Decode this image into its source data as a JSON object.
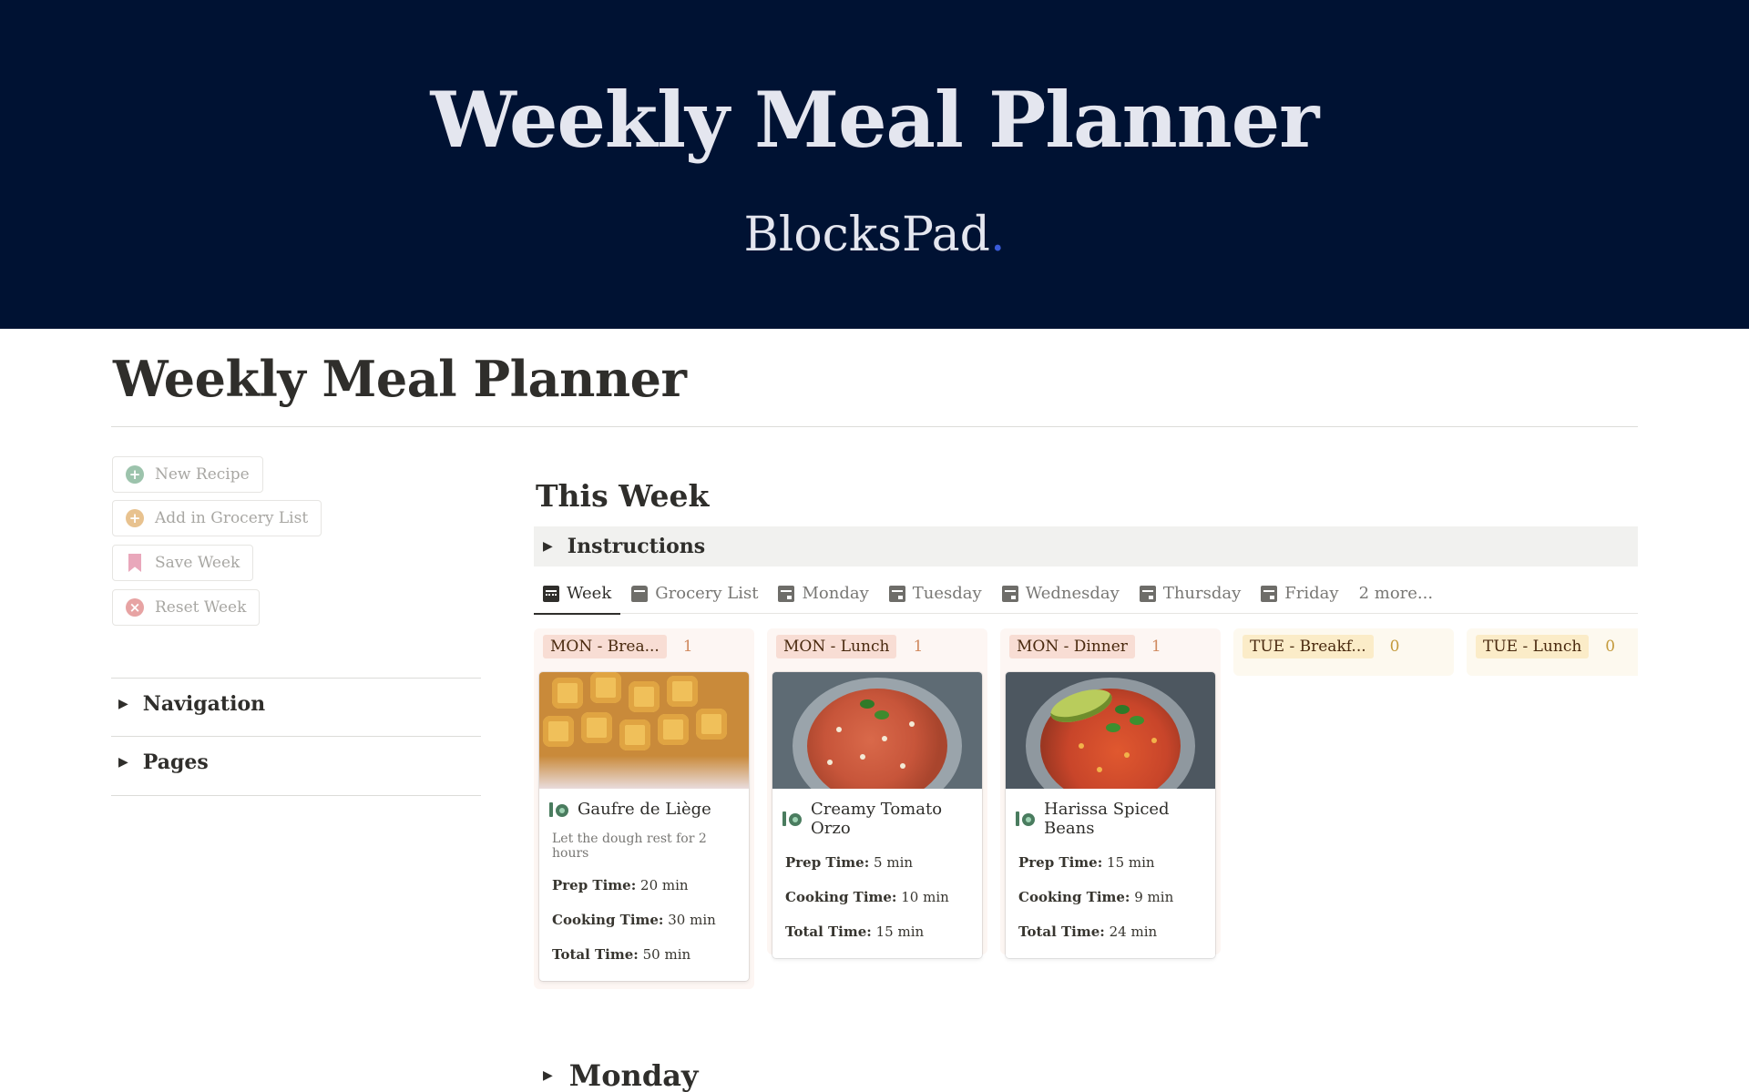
{
  "banner": {
    "title": "Weekly Meal Planner",
    "brand": "BlocksPad",
    "brand_dot": "."
  },
  "page": {
    "title": "Weekly Meal Planner"
  },
  "actions": [
    {
      "label": "New Recipe",
      "icon": "plus-circle-icon",
      "color": "#9cc3ac"
    },
    {
      "label": "Add in Grocery List",
      "icon": "plus-circle-icon",
      "color": "#e8c28f"
    },
    {
      "label": "Save Week",
      "icon": "bookmark-icon",
      "color": "#e9a7bb"
    },
    {
      "label": "Reset Week",
      "icon": "x-circle-icon",
      "color": "#e7a3a3"
    }
  ],
  "sidebar": {
    "toggles": [
      "Navigation",
      "Pages"
    ]
  },
  "main": {
    "section_title": "This Week",
    "instructions": "Instructions",
    "tabs": [
      "Week",
      "Grocery List",
      "Monday",
      "Tuesday",
      "Wednesday",
      "Thursday",
      "Friday"
    ],
    "tabs_more": "2 more...",
    "next_section": "Monday"
  },
  "board": {
    "columns": [
      {
        "tag": "MON - Brea...",
        "count": "1",
        "color": "pink"
      },
      {
        "tag": "MON - Lunch",
        "count": "1",
        "color": "pink"
      },
      {
        "tag": "MON - Dinner",
        "count": "1",
        "color": "pink"
      },
      {
        "tag": "TUE - Breakf...",
        "count": "0",
        "color": "yellow"
      },
      {
        "tag": "TUE - Lunch",
        "count": "0",
        "color": "yellow"
      }
    ],
    "cards": [
      {
        "title": "Gaufre de Liège",
        "note": "Let the dough rest for 2 hours",
        "prep_label": "Prep Time:",
        "prep": "20 min",
        "cook_label": "Cooking Time:",
        "cook": "30 min",
        "total_label": "Total Time:",
        "total": "50 min"
      },
      {
        "title": "Creamy Tomato Orzo",
        "prep_label": "Prep Time:",
        "prep": "5 min",
        "cook_label": "Cooking Time:",
        "cook": "10 min",
        "total_label": "Total Time:",
        "total": "15 min"
      },
      {
        "title": "Harissa Spiced Beans",
        "prep_label": "Prep Time:",
        "prep": "15 min",
        "cook_label": "Cooking Time:",
        "cook": "9 min",
        "total_label": "Total Time:",
        "total": "24 min"
      }
    ]
  },
  "colors": {
    "banner_bg": "#001233",
    "brand_dot": "#3a5bd9",
    "column_pink": "#fdf6f3",
    "column_yellow": "#fdf9ef"
  }
}
